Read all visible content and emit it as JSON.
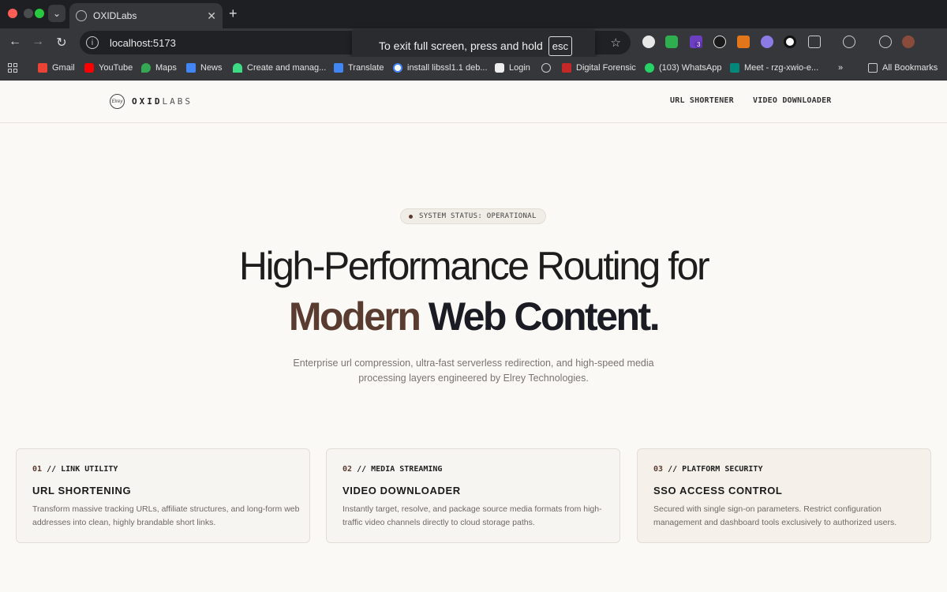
{
  "browser": {
    "tab_title": "OXIDLabs",
    "url": "localhost:5173",
    "fullscreen_toast": {
      "message": "To exit full screen, press and hold",
      "key": "esc"
    },
    "extension_badge": "3",
    "bookmarks": [
      {
        "label": "Gmail",
        "icon": "gmail-icon"
      },
      {
        "label": "YouTube",
        "icon": "youtube-icon"
      },
      {
        "label": "Maps",
        "icon": "maps-icon"
      },
      {
        "label": "News",
        "icon": "news-icon"
      },
      {
        "label": "Create and manag...",
        "icon": "android-icon"
      },
      {
        "label": "Translate",
        "icon": "translate-icon"
      },
      {
        "label": "install libssl1.1 deb...",
        "icon": "google-icon"
      },
      {
        "label": "Login",
        "icon": "login-icon"
      },
      {
        "label": "",
        "icon": "globe-icon"
      },
      {
        "label": "Digital Forensic",
        "icon": "forensic-icon"
      },
      {
        "label": "(103) WhatsApp",
        "icon": "whatsapp-icon"
      },
      {
        "label": "Meet - rzg-xwio-e...",
        "icon": "meet-icon"
      }
    ],
    "all_bookmarks": "All Bookmarks",
    "more_chevron": "»"
  },
  "site": {
    "logo_badge": "Elrey",
    "logo_bold": "OXID",
    "logo_light": "LABS",
    "nav": [
      "URL SHORTENER",
      "VIDEO DOWNLOADER"
    ]
  },
  "hero": {
    "status": "SYSTEM STATUS: OPERATIONAL",
    "line1": "High-Performance Routing for",
    "line2_accent": "Modern",
    "line2_rest": " Web Content.",
    "subtitle": "Enterprise url compression, ultra-fast serverless redirection, and high-speed media processing layers engineered by Elrey Technologies."
  },
  "cards": [
    {
      "num": "01",
      "tag": " // LINK UTILITY",
      "title": "URL SHORTENING",
      "desc": "Transform massive tracking URLs, affiliate structures, and long-form web addresses into clean, highly brandable short links."
    },
    {
      "num": "02",
      "tag": " // MEDIA STREAMING",
      "title": "VIDEO DOWNLOADER",
      "desc": "Instantly target, resolve, and package source media formats from high-traffic video channels directly to cloud storage paths."
    },
    {
      "num": "03",
      "tag": " // PLATFORM SECURITY",
      "title": "SSO ACCESS CONTROL",
      "desc": "Secured with single sign-on parameters. Restrict configuration management and dashboard tools exclusively to authorized users."
    }
  ]
}
